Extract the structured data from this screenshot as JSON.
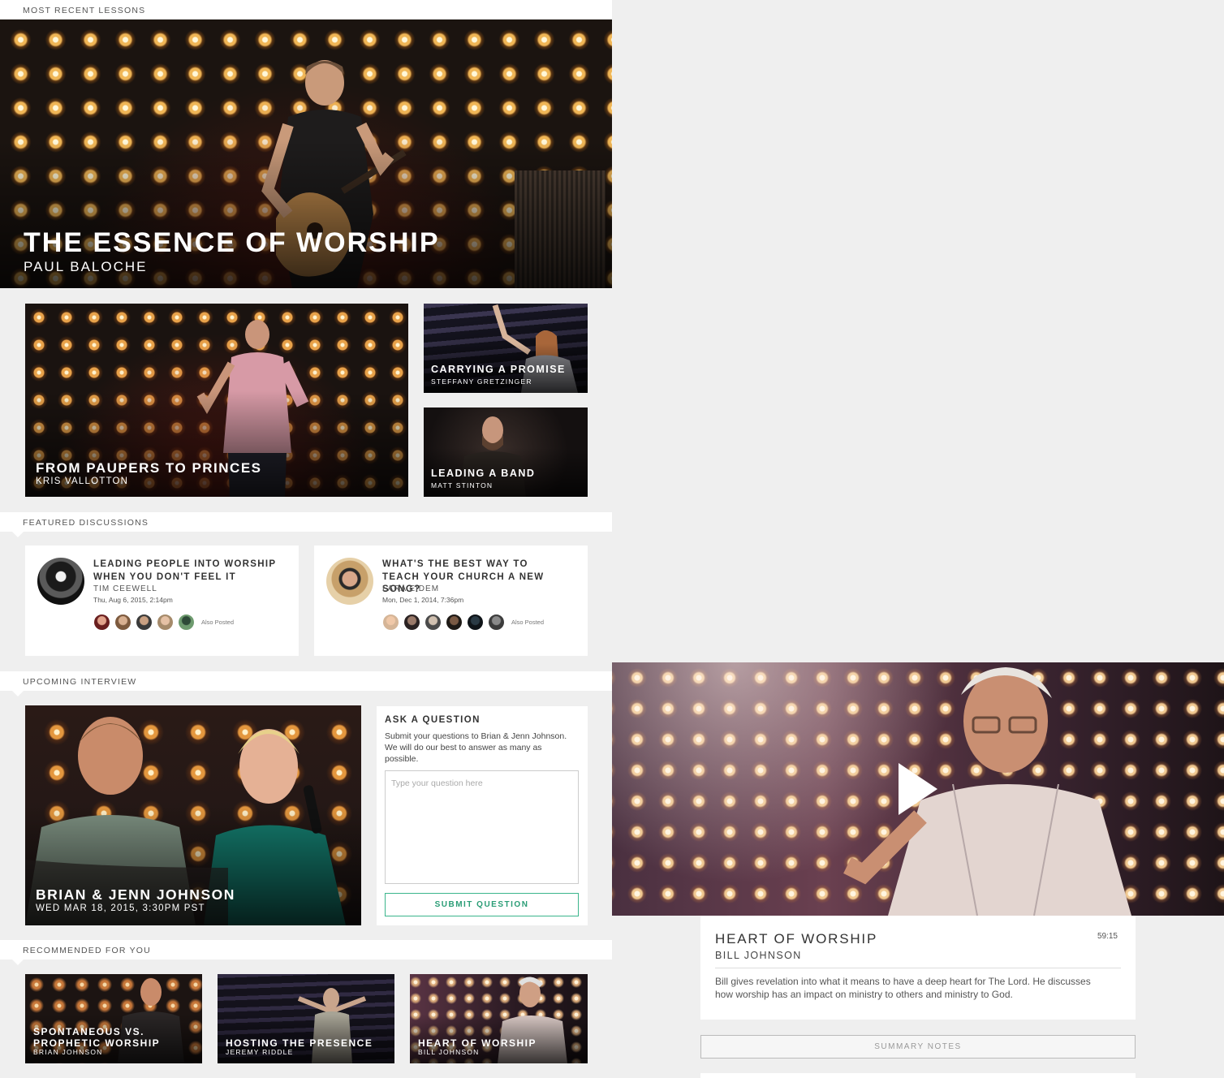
{
  "sections": {
    "recent": "Most Recent Lessons",
    "featured": "Featured Discussions",
    "upcoming": "Upcoming Interview",
    "recommended": "Recommended For You"
  },
  "hero": {
    "title": "The Essence of Worship",
    "speaker": "Paul Baloche"
  },
  "lessons": [
    {
      "title": "From Paupers to Princes",
      "speaker": "Kris Vallotton"
    },
    {
      "title": "Carrying a Promise",
      "speaker": "Steffany Gretzinger"
    },
    {
      "title": "Leading a Band",
      "speaker": "Matt Stinton"
    }
  ],
  "discussions": [
    {
      "title": "Leading People Into Worship When You Don't Feel It",
      "author": "Tim Ceewell",
      "date": "Thu, Aug 6, 2015, 2:14pm",
      "also": "Also Posted"
    },
    {
      "title": "What's the Best Way to Teach Your Church a New Song?",
      "author": "Lara Eidem",
      "date": "Mon, Dec 1, 2014, 7:36pm",
      "also": "Also Posted"
    }
  ],
  "interview": {
    "title": "Brian & Jenn Johnson",
    "date": "Wed Mar 18, 2015, 3:30PM PST"
  },
  "ask": {
    "heading": "Ask a Question",
    "text": "Submit your questions to Brian & Jenn Johnson. We will do our best to answer as many as possible.",
    "placeholder": "Type your question here",
    "button": "Submit Question"
  },
  "recommended": [
    {
      "title": "Spontaneous vs. Prophetic Worship",
      "speaker": "Brian Johnson"
    },
    {
      "title": "Hosting the Presence",
      "speaker": "Jeremy Riddle"
    },
    {
      "title": "Heart of Worship",
      "speaker": "Bill Johnson"
    }
  ],
  "video": {
    "title": "Heart of Worship",
    "speaker": "Bill Johnson",
    "duration": "59:15",
    "description": "Bill gives revelation into what it means to have a deep heart for The Lord. He discusses how worship has an impact on ministry to others and ministry to God.",
    "summary_button": "Summary Notes"
  },
  "colors": {
    "accent": "#3bb58c",
    "background": "#efefef"
  }
}
